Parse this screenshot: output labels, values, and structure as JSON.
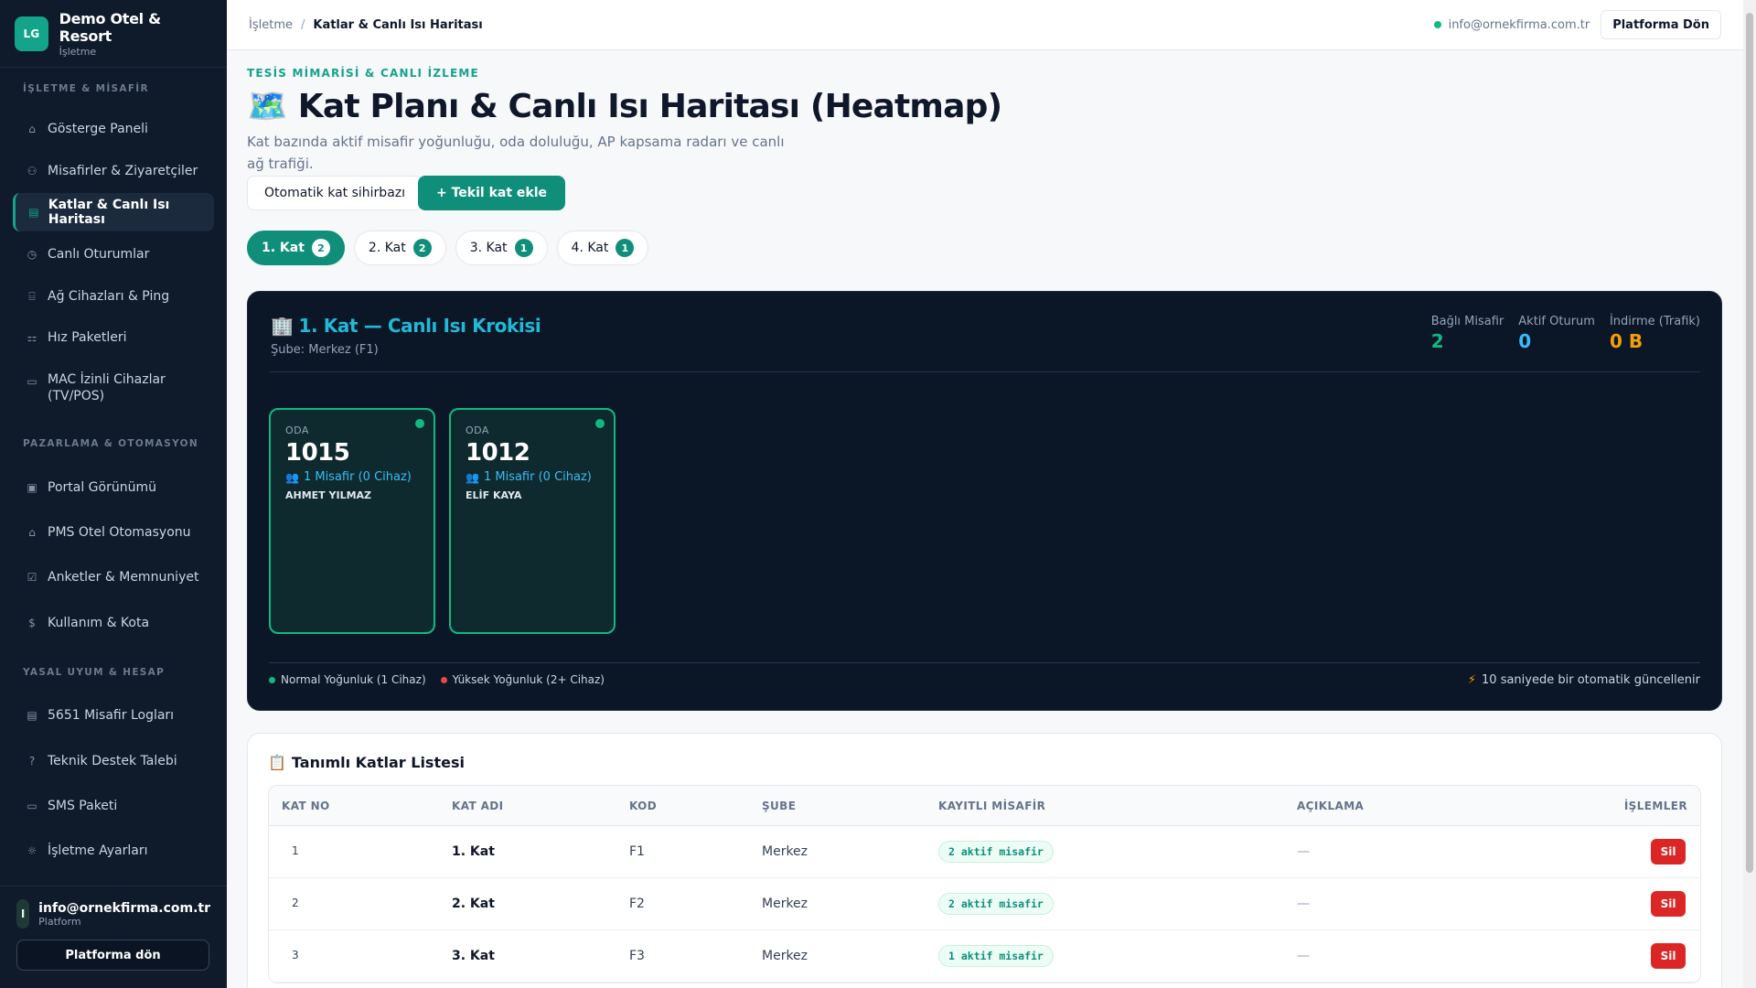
{
  "brand": {
    "logo": "LG",
    "name": "Demo Otel & Resort",
    "sub": "İşletme"
  },
  "sidebar": {
    "sections": [
      "İŞLETME & MİSAFİR",
      "PAZARLAMA & OTOMASYON",
      "YASAL UYUM & HESAP"
    ],
    "items": [
      {
        "label": "Gösterge Paneli",
        "icon": "home-icon",
        "active": false
      },
      {
        "label": "Misafirler & Ziyaretçiler",
        "icon": "users-icon",
        "active": false
      },
      {
        "label": "Katlar & Canlı Isı Haritası",
        "icon": "map-icon",
        "active": true
      },
      {
        "label": "Canlı Oturumlar",
        "icon": "clock-icon",
        "active": false
      },
      {
        "label": "Ağ Cihazları & Ping",
        "icon": "router-icon",
        "active": false
      },
      {
        "label": "Hız Paketleri",
        "icon": "speed-icon",
        "active": false
      },
      {
        "label": "MAC İzinli Cihazlar (TV/POS)",
        "icon": "monitor-icon",
        "active": false
      },
      {
        "label": "Portal Görünümü",
        "icon": "portal-icon",
        "active": false
      },
      {
        "label": "PMS Otel Otomasyonu",
        "icon": "hotel-icon",
        "active": false
      },
      {
        "label": "Anketler & Memnuniyet",
        "icon": "checkbox-icon",
        "active": false
      },
      {
        "label": "Kullanım & Kota",
        "icon": "dollar-icon",
        "active": false
      },
      {
        "label": "5651 Misafir Logları",
        "icon": "log-icon",
        "active": false
      },
      {
        "label": "Teknik Destek Talebi",
        "icon": "help-icon",
        "active": false
      },
      {
        "label": "SMS Paketi",
        "icon": "message-icon",
        "active": false
      },
      {
        "label": "İşletme Ayarları",
        "icon": "gear-icon",
        "active": false
      }
    ],
    "user": {
      "avatar": "I",
      "email": "info@ornekfirma.com.tr",
      "role": "Platform",
      "button": "Platforma dön"
    }
  },
  "topbar": {
    "breadcrumb_root": "İşletme",
    "breadcrumb_sep": "/",
    "breadcrumb_current": "Katlar & Canlı Isı Haritası",
    "email": "info@ornekfirma.com.tr",
    "button": "Platforma Dön"
  },
  "page": {
    "eyebrow": "TESİS MİMARİSİ & CANLI İZLEME",
    "title_icon": "🗺️",
    "title": "Kat Planı & Canlı Isı Haritası (Heatmap)",
    "description": "Kat bazında aktif misafir yoğunluğu, oda doluluğu, AP kapsama radarı ve canlı ağ trafiği.",
    "btn_wizard": "Otomatik kat sihirbazı",
    "btn_add": "+ Tekil kat ekle"
  },
  "tabs": [
    {
      "label": "1. Kat",
      "count": "2",
      "active": true
    },
    {
      "label": "2. Kat",
      "count": "2",
      "active": false
    },
    {
      "label": "3. Kat",
      "count": "1",
      "active": false
    },
    {
      "label": "4. Kat",
      "count": "1",
      "active": false
    }
  ],
  "heatmap": {
    "title_icon": "🏢",
    "title": "1. Kat — Canlı Isı Krokisi",
    "subtitle": "Şube: Merkez (F1)",
    "stats": [
      {
        "label": "Bağlı Misafir",
        "value": "2",
        "color": "#10b981"
      },
      {
        "label": "Aktif Oturum",
        "value": "0",
        "color": "#38bdf8"
      },
      {
        "label": "İndirme (Trafik)",
        "value": "0 B",
        "color": "#f59e0b"
      }
    ],
    "rooms": [
      {
        "label": "ODA",
        "number": "1015",
        "guests": "1 Misafir (0 Cihaz)",
        "name": "AHMET YILMAZ"
      },
      {
        "label": "ODA",
        "number": "1012",
        "guests": "1 Misafir (0 Cihaz)",
        "name": "ELİF KAYA"
      }
    ],
    "legend": [
      {
        "label": "Normal Yoğunluk (1 Cihaz)",
        "color": "#10b981"
      },
      {
        "label": "Yüksek Yoğunluk (2+ Cihaz)",
        "color": "#ef4444"
      }
    ],
    "auto_update": "10 saniyede bir otomatik güncellenir"
  },
  "floors_list": {
    "title_icon": "📋",
    "title": "Tanımlı Katlar Listesi",
    "columns": [
      "KAT NO",
      "KAT ADI",
      "KOD",
      "ŞUBE",
      "KAYITLI MİSAFİR",
      "AÇIKLAMA",
      "İŞLEMLER"
    ],
    "rows": [
      {
        "no": "1",
        "name": "1. Kat",
        "code": "F1",
        "branch": "Merkez",
        "guests": "2 aktif misafir",
        "desc": "—",
        "action": "Sil"
      },
      {
        "no": "2",
        "name": "2. Kat",
        "code": "F2",
        "branch": "Merkez",
        "guests": "2 aktif misafir",
        "desc": "—",
        "action": "Sil"
      },
      {
        "no": "3",
        "name": "3. Kat",
        "code": "F3",
        "branch": "Merkez",
        "guests": "1 aktif misafir",
        "desc": "—",
        "action": "Sil"
      }
    ]
  }
}
